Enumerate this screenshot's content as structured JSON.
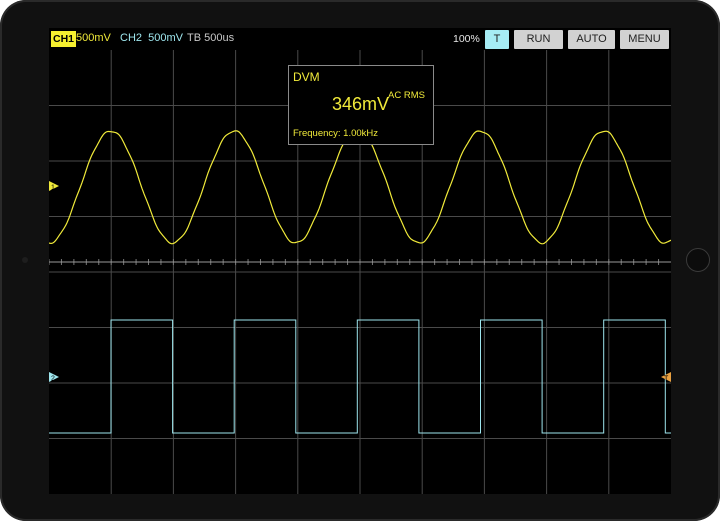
{
  "header": {
    "ch1_badge": "CH1",
    "ch1_scale": "500mV",
    "ch2_label": "CH2  500mV",
    "timebase": "TB 500us",
    "zoom": "100%"
  },
  "buttons": {
    "trigger": "T",
    "run": "RUN",
    "auto": "AUTO",
    "menu": "MENU"
  },
  "dvm": {
    "title": "DVM",
    "value": "346mV",
    "mode": "AC RMS",
    "frequency": "Frequency: 1.00kHz"
  },
  "markers": {
    "ch1": "1",
    "ch2": "2",
    "trigger": "T"
  },
  "colors": {
    "ch1": "#f0ea3a",
    "ch2": "#9ee6ee",
    "trigger_marker": "#e8a040",
    "grid": "#4a4a4a",
    "axis": "#9a9a9a",
    "screen_bg": "#000000"
  },
  "signals": {
    "ch1_waveform": "sine",
    "ch2_waveform": "square",
    "cycles_visible": 5
  }
}
